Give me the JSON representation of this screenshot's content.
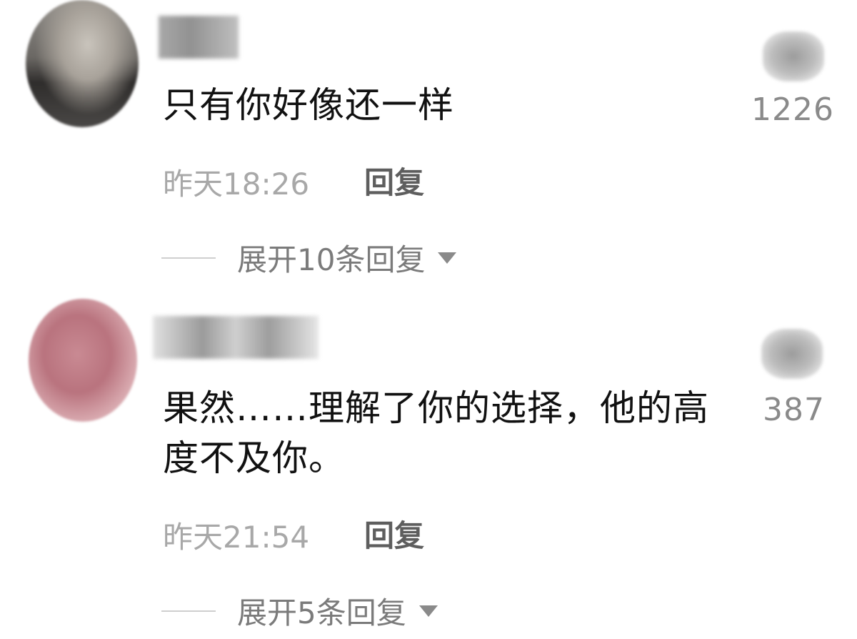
{
  "comments": [
    {
      "text": "只有你好像还一样",
      "time": "昨天18:26",
      "reply_label": "回复",
      "likes": "1226",
      "expand_label": "展开10条回复"
    },
    {
      "text": "果然……理解了你的选择，他的高度不及你。",
      "time": "昨天21:54",
      "reply_label": "回复",
      "likes": "387",
      "expand_label": "展开5条回复"
    }
  ],
  "icons": {
    "like": "thumbs-up-icon",
    "expand": "caret-down-icon"
  },
  "colors": {
    "text": "#111111",
    "meta": "#a8a8a8",
    "reply": "#5e5e5e",
    "expand": "#7b7b7b"
  }
}
